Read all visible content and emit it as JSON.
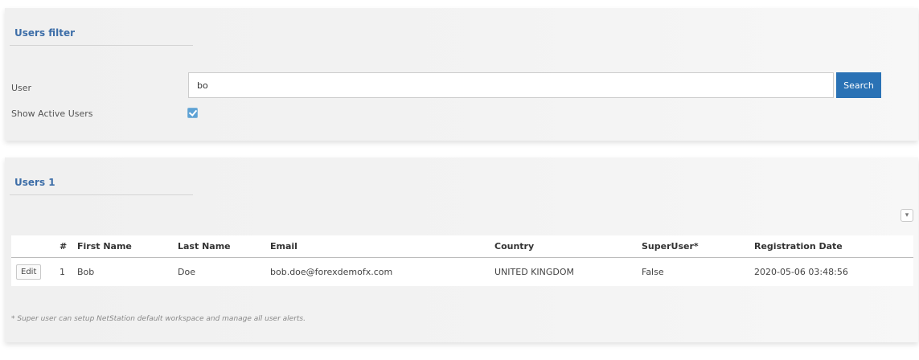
{
  "filter": {
    "title": "Users filter",
    "user_label": "User",
    "user_value": "bo",
    "search_label": "Search",
    "show_active_label": "Show Active Users",
    "show_active_checked": true
  },
  "users": {
    "title": "Users 1",
    "expand_glyph": "▾",
    "columns": [
      "",
      "#",
      "First Name",
      "Last Name",
      "Email",
      "Country",
      "SuperUser*",
      "Registration Date"
    ],
    "rows": [
      {
        "edit_label": "Edit",
        "index": "1",
        "first_name": "Bob",
        "last_name": "Doe",
        "email": "bob.doe@forexdemofx.com",
        "country": "UNITED KINGDOM",
        "super_user": "False",
        "registration_date": "2020-05-06 03:48:56"
      }
    ],
    "footnote": "* Super user can setup NetStation default workspace and manage all user alerts."
  },
  "colors": {
    "accent": "#2a72b5",
    "title": "#3d6ea8",
    "checkbox": "#5da2d5"
  }
}
